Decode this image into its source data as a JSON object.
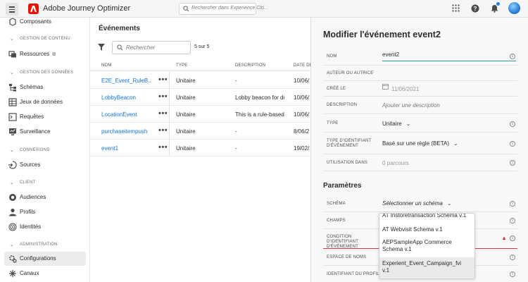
{
  "app": {
    "title": "Adobe Journey Optimizer",
    "search_placeholder": "Rechercher dans Experience Clo..."
  },
  "sidebar": {
    "top_item": "Composants",
    "sections": [
      {
        "label": "GESTION DE CONTENU",
        "items": [
          "Ressources"
        ]
      },
      {
        "label": "GESTION DES DONNÉES",
        "items": [
          "Schémas",
          "Jeux de données",
          "Requêtes",
          "Surveillance"
        ]
      },
      {
        "label": "CONNEXIONS",
        "items": [
          "Sources"
        ]
      },
      {
        "label": "CLIENT",
        "items": [
          "Audiences",
          "Profils",
          "Identités"
        ]
      },
      {
        "label": "ADMINISTRATION",
        "items": [
          "Configurations",
          "Canaux"
        ]
      }
    ],
    "active": "Configurations"
  },
  "list": {
    "title": "Événements",
    "search_placeholder": "Rechercher",
    "count": "5 sur 5",
    "columns": [
      "NOM",
      "TYPE",
      "DESCRIPTION",
      "DATE DE"
    ],
    "rows": [
      {
        "name": "E2E_Event_RuleB...",
        "type": "Unitaire",
        "description": "-",
        "date": "10/06/2"
      },
      {
        "name": "LobbyBeacon",
        "type": "Unitaire",
        "description": "Lobby beacon for do",
        "date": "10/06/2"
      },
      {
        "name": "LocationEvent",
        "type": "Unitaire",
        "description": "This is a rule-based e",
        "date": "10/06/2"
      },
      {
        "name": "purchaseitempush",
        "type": "Unitaire",
        "description": "-",
        "date": "8/06/2"
      },
      {
        "name": "event1",
        "type": "Unitaire",
        "description": "-",
        "date": "19/02/2"
      }
    ]
  },
  "editor": {
    "title": "Modifier l'événement event2",
    "fields": {
      "nom_label": "NOM",
      "nom_value": "event2",
      "auteur_label": "AUTEUR OU AUTRICE",
      "cree_label": "CRÉÉ LE",
      "cree_value": "11/06/2021",
      "desc_label": "DESCRIPTION",
      "desc_placeholder": "Ajouter une description",
      "type_label": "TYPE",
      "type_value": "Unitaire",
      "typeid_label": "TYPE D'IDENTIFIANT D'ÉVÉNEMENT",
      "typeid_value": "Basé sur une règle (BETA)",
      "usage_label": "UTILISATION DANS",
      "usage_value": "0 parcours"
    },
    "params_title": "Paramètres",
    "params": {
      "schema_label": "SCHÉMA",
      "schema_value": "Sélectionner un schéma",
      "champs_label": "CHAMPS",
      "condition_label": "CONDITION D'IDENTIFIANT D'ÉVÉNEMENT",
      "espace_label": "ESPACE DE NOMS",
      "profil_label": "IDENTIFIANT DU PROFIL"
    },
    "schema_options": [
      "AT Instoretransaction Schema v.1",
      "AT Webvisit Schema v.1",
      "AEPSampleApp Commerce Schema v.1",
      "Experient_Event_Campaign_fvi v.1"
    ]
  }
}
